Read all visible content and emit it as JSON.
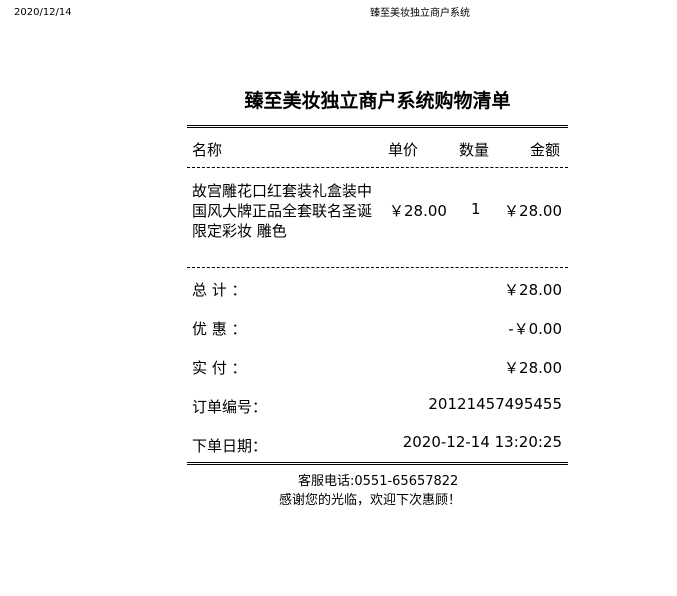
{
  "page_header": {
    "date": "2020/12/14",
    "title": "臻至美妆独立商户系统"
  },
  "receipt": {
    "title": "臻至美妆独立商户系统购物清单",
    "columns": {
      "name": "名称",
      "unit_price": "单价",
      "quantity": "数量",
      "amount": "金额"
    },
    "items": [
      {
        "name": "故宫雕花口红套装礼盒装中国风大牌正品全套联名圣诞限定彩妆 雕色",
        "unit_price": "￥28.00",
        "quantity": "1",
        "amount": "￥28.00"
      }
    ],
    "summary": {
      "total_label": "总 计 ：",
      "total_value": "￥28.00",
      "discount_label": "优 惠 ：",
      "discount_value": "-￥0.00",
      "paid_label": "实 付 ：",
      "paid_value": "￥28.00",
      "order_no_label": "订单编号：",
      "order_no_value": "20121457495455",
      "order_date_label": "下单日期：",
      "order_date_value": "2020-12-14 13:20:25"
    }
  },
  "footer": {
    "service_phone": "客服电话:0551-65657822",
    "thanks": "感谢您的光临，欢迎下次惠顾！"
  }
}
